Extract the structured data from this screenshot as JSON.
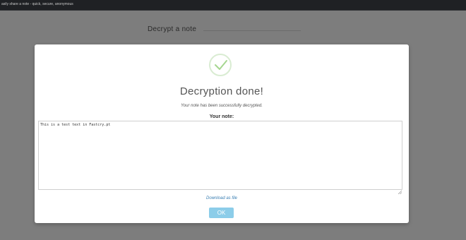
{
  "topbar": {
    "tagline": "asily share a note - quick, secure, anonymous"
  },
  "background": {
    "card_title": "Decrypt a note"
  },
  "modal": {
    "icon": "check-icon",
    "heading": "Decryption done!",
    "description": "Your note has been successfully decrypted.",
    "note_label": "Your note:",
    "note_value": "This is a test text in Fastcry.pt",
    "download_label": "Download as file",
    "ok_label": "OK"
  },
  "colors": {
    "accent": "#8ccde9",
    "success": "#a5d68f",
    "link": "#3b7fb3"
  }
}
